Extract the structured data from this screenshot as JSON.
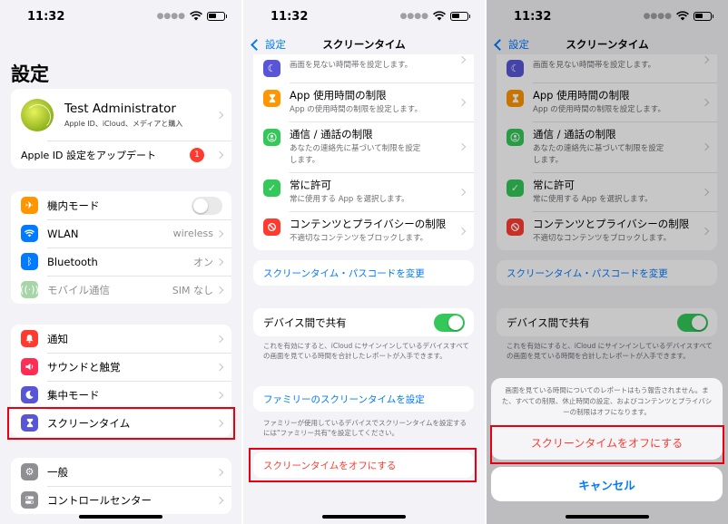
{
  "status": {
    "time": "11:32"
  },
  "colors": {
    "blue": "#007aff",
    "red": "#ff3b30",
    "green": "#34c759",
    "highlight": "#e60012"
  },
  "settings": {
    "title": "設定",
    "profile": {
      "name": "Test Administrator",
      "subtitle": "Apple ID、iCloud、メディアと購入"
    },
    "appleid_update": {
      "label": "Apple ID 設定をアップデート",
      "badge": "1"
    },
    "connectivity": [
      {
        "icon": "airplane-icon",
        "label": "機内モード",
        "color": "#ff9500"
      },
      {
        "icon": "wifi-icon",
        "label": "WLAN",
        "value": "wireless",
        "color": "#007aff"
      },
      {
        "icon": "bluetooth-icon",
        "label": "Bluetooth",
        "value": "オン",
        "color": "#007aff"
      },
      {
        "icon": "antenna-icon",
        "label": "モバイル通信",
        "value": "SIM なし",
        "color": "#a8d5a8"
      }
    ],
    "notifications": [
      {
        "icon": "bell-icon",
        "label": "通知",
        "color": "#ff3b30"
      },
      {
        "icon": "speaker-icon",
        "label": "サウンドと触覚",
        "color": "#ff2d55"
      },
      {
        "icon": "moon-icon",
        "label": "集中モード",
        "color": "#5856d6"
      },
      {
        "icon": "hourglass-icon",
        "label": "スクリーンタイム",
        "color": "#5856d6"
      }
    ],
    "general": [
      {
        "icon": "gear-icon",
        "label": "一般",
        "color": "#8e8e93"
      },
      {
        "icon": "switches-icon",
        "label": "コントロールセンター",
        "color": "#8e8e93"
      }
    ]
  },
  "screentime": {
    "back": "設定",
    "title": "スクリーンタイム",
    "top_row": {
      "sub": "画面を見ない時間帯を設定します。"
    },
    "items": [
      {
        "icon": "hourglass-icon",
        "title": "App 使用時間の制限",
        "sub": "App の使用時間の制限を設定します。",
        "color": "#ff9500"
      },
      {
        "icon": "contact-icon",
        "title": "通信 / 通話の制限",
        "sub": "あなたの連絡先に基づいて制限を設定します。",
        "color": "#34c759"
      },
      {
        "icon": "checkmark-icon",
        "title": "常に許可",
        "sub": "常に使用する App を選択します。",
        "color": "#34c759"
      },
      {
        "icon": "restriction-icon",
        "title": "コンテンツとプライバシーの制限",
        "sub": "不適切なコンテンツをブロックします。",
        "color": "#ff3b30"
      }
    ],
    "passcode_link": "スクリーンタイム・パスコードを変更",
    "share": {
      "label": "デバイス間で共有",
      "note": "これを有効にすると、iCloud にサインインしているデバイスすべての画面を見ている時間を合計したレポートが入手できます。"
    },
    "family_link": "ファミリーのスクリーンタイムを設定",
    "family_note": "ファミリーが使用しているデバイスでスクリーンタイムを設定するには\"ファミリー共有\"を設定してください。",
    "turn_off": "スクリーンタイムをオフにする"
  },
  "sheet": {
    "message": "画面を見ている時間についてのレポートはもう報告されません。また、すべての制限、休止時間の設定、およびコンテンツとプライバシーの制限はオフになります。",
    "confirm": "スクリーンタイムをオフにする",
    "cancel": "キャンセル"
  }
}
